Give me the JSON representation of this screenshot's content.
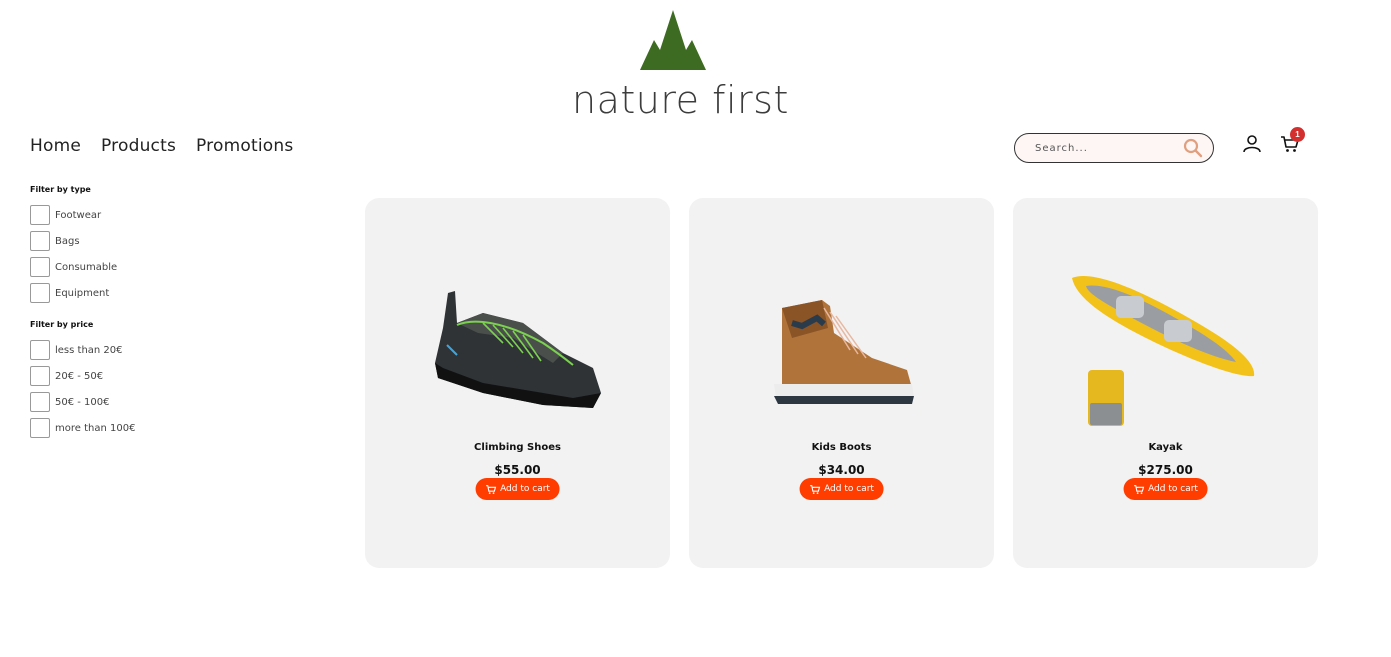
{
  "brand": {
    "name": "nature first",
    "logo_color": "#3d6b21"
  },
  "nav": {
    "items": [
      {
        "label": "Home"
      },
      {
        "label": "Products"
      },
      {
        "label": "Promotions"
      }
    ]
  },
  "search": {
    "placeholder": "Search..."
  },
  "cart": {
    "count": "1"
  },
  "filters": {
    "type": {
      "title": "Filter by type",
      "options": [
        {
          "label": "Footwear"
        },
        {
          "label": "Bags"
        },
        {
          "label": "Consumable"
        },
        {
          "label": "Equipment"
        }
      ]
    },
    "price": {
      "title": "Filter by price",
      "options": [
        {
          "label": "less than 20€"
        },
        {
          "label": "20€ - 50€"
        },
        {
          "label": "50€ - 100€"
        },
        {
          "label": "more than 100€"
        }
      ]
    }
  },
  "products": [
    {
      "name": "Climbing Shoes",
      "price": "$55.00",
      "button": "Add to cart"
    },
    {
      "name": "Kids Boots",
      "price": "$34.00",
      "button": "Add to cart"
    },
    {
      "name": "Kayak",
      "price": "$275.00",
      "button": "Add to cart"
    }
  ],
  "colors": {
    "accent": "#ff3d00",
    "badge": "#d32f2f",
    "card_bg": "#f2f2f2"
  }
}
